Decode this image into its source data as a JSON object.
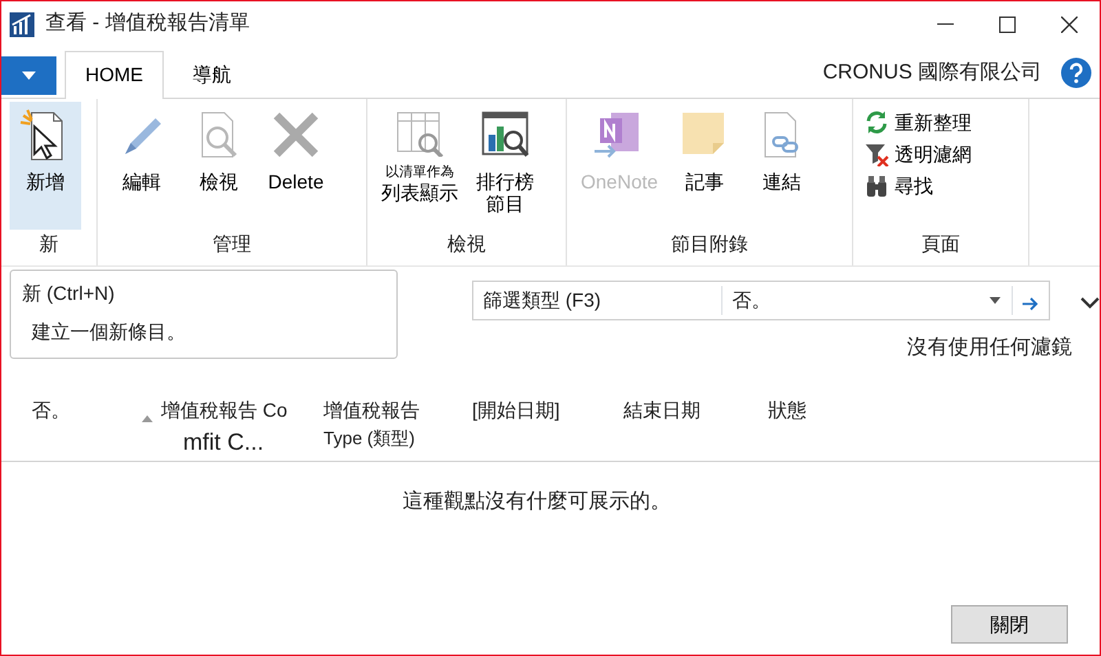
{
  "window": {
    "title": "查看 - 增值稅報告清單"
  },
  "tabs": [
    {
      "label": "HOME",
      "selected": true
    },
    {
      "label": "導航",
      "selected": false
    }
  ],
  "company": "CRONUS 國際有限公司",
  "ribbon": [
    {
      "label": "新",
      "buttons": [
        {
          "kind": "large",
          "label": "新增",
          "disabled": false,
          "selected": true
        }
      ]
    },
    {
      "label": "管理",
      "buttons": [
        {
          "kind": "large",
          "label": "編輯",
          "disabled": false,
          "selected": false
        },
        {
          "kind": "large",
          "label": "檢視",
          "disabled": false,
          "selected": false
        },
        {
          "kind": "large",
          "label": "Delete",
          "disabled": false,
          "selected": false
        }
      ]
    },
    {
      "label": "檢視",
      "buttons": [
        {
          "kind": "large",
          "caption": "以清單作為",
          "label": "列表顯示",
          "disabled": false,
          "selected": false
        },
        {
          "kind": "large",
          "lines": [
            "排行榜",
            "節目"
          ],
          "disabled": false,
          "selected": false
        }
      ]
    },
    {
      "label": "節目附錄",
      "buttons": [
        {
          "kind": "large",
          "label": "OneNote",
          "disabled": true,
          "selected": false
        },
        {
          "kind": "large",
          "label": "記事",
          "disabled": false,
          "selected": false
        },
        {
          "kind": "large",
          "label": "連結",
          "disabled": false,
          "selected": false
        }
      ]
    },
    {
      "label": "頁面",
      "buttons": [
        {
          "kind": "small",
          "label": "重新整理",
          "disabled": false,
          "selected": false
        },
        {
          "kind": "small",
          "label": "透明濾網",
          "disabled": false,
          "selected": false
        },
        {
          "kind": "small",
          "label": "尋找",
          "disabled": false,
          "selected": false
        }
      ]
    }
  ],
  "tooltip": {
    "title": "新 (Ctrl+N)",
    "description": "建立一個新條目。"
  },
  "filter": {
    "label": "篩選類型 (F3)",
    "value": "否。"
  },
  "filter_status": "沒有使用任何濾鏡",
  "columns": [
    {
      "lines": [
        "否。"
      ],
      "sorted": false
    },
    {
      "lines": [
        "增值稅報告 Co",
        "mfit C..."
      ],
      "sorted": true
    },
    {
      "lines": [
        "增值稅報告",
        "Type (類型)"
      ],
      "sorted": false
    },
    {
      "lines": [
        "[開始日期]"
      ],
      "sorted": false
    },
    {
      "lines": [
        "結束日期"
      ],
      "sorted": false
    },
    {
      "lines": [
        "狀態"
      ],
      "sorted": false
    }
  ],
  "empty_message": "這種觀點沒有什麼可展示的。",
  "close_button": "關閉"
}
